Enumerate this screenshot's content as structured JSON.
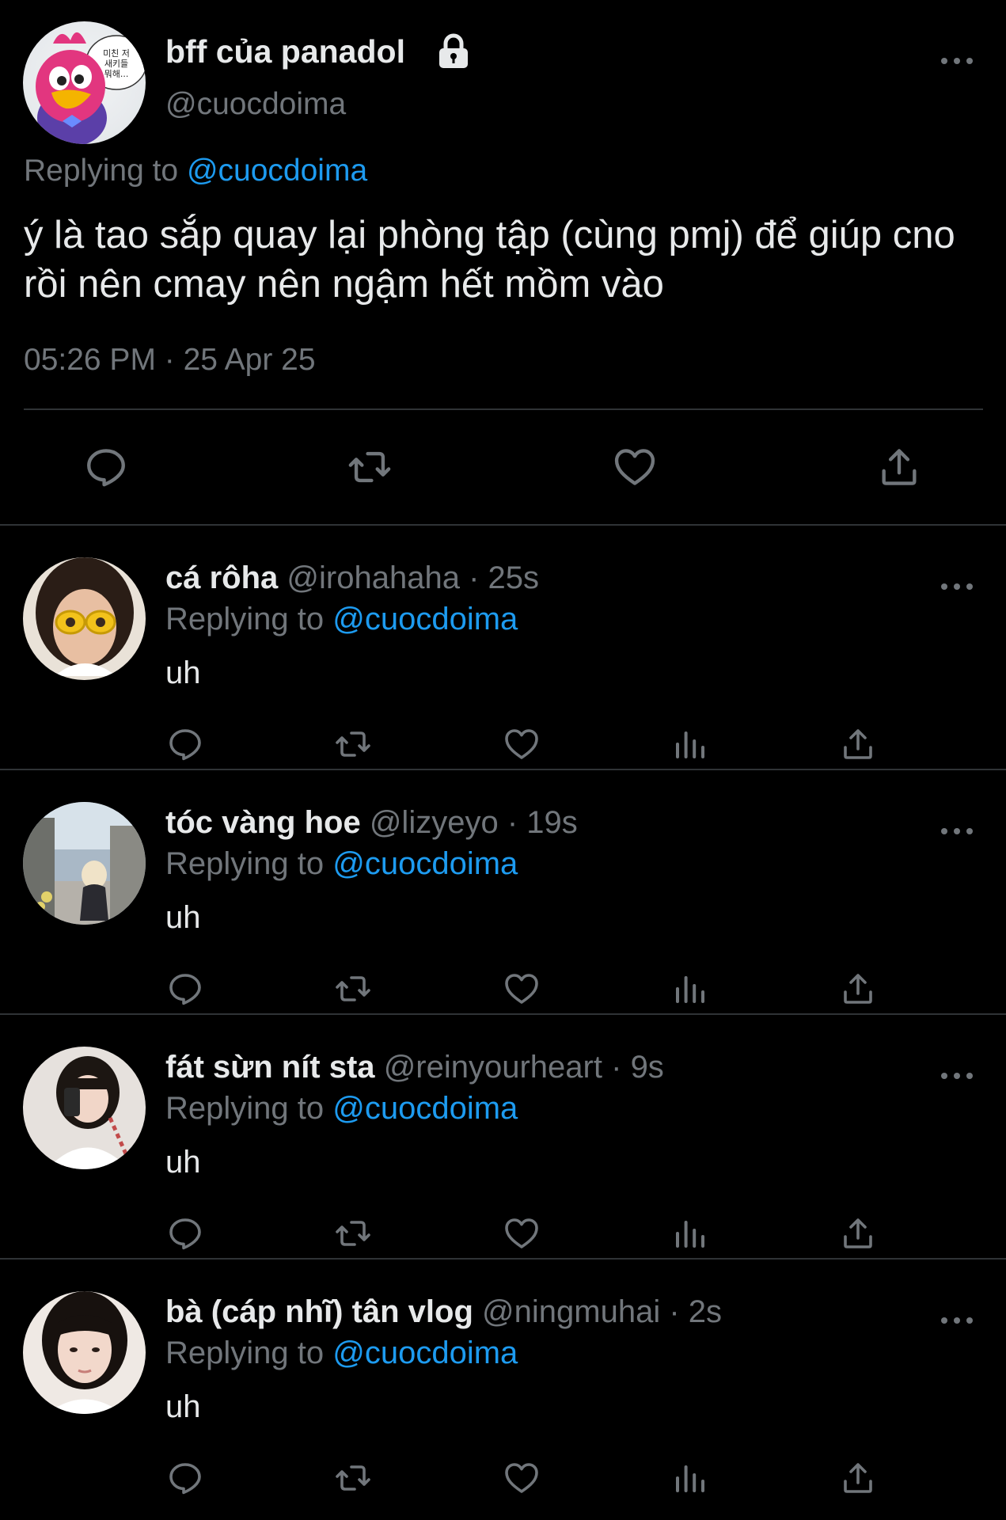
{
  "main_tweet": {
    "avatar": "cartoon-penguin-avatar",
    "avatar_speech_text": "미친 저 새키들 뭐해...",
    "display_name": "bff của panadol",
    "handle": "@cuocdoima",
    "replying_prefix": "Replying to ",
    "replying_to": "@cuocdoima",
    "text": "ý là tao sắp quay lại phòng tập (cùng pmj) để giúp cno rồi nên cmay nên ngậm hết mồm vào",
    "timestamp": "05:26 PM · 25 Apr 25",
    "icons": {
      "protected": "lock-icon",
      "more": "more-icon",
      "actions": [
        "reply-icon",
        "retweet-icon",
        "like-icon",
        "share-icon"
      ]
    }
  },
  "replies": [
    {
      "display_name": "cá rôha",
      "handle": "@irohahaha",
      "separator": "·",
      "time": "25s",
      "replying_prefix": "Replying to ",
      "replying_to": "@cuocdoima",
      "text": "uh"
    },
    {
      "display_name": "tóc vàng hoe",
      "handle": "@lizyeyo",
      "separator": "·",
      "time": "19s",
      "replying_prefix": "Replying to ",
      "replying_to": "@cuocdoima",
      "text": "uh"
    },
    {
      "display_name": "fát sừn nít sta",
      "handle": "@reinyourheart",
      "separator": "·",
      "time": "9s",
      "replying_prefix": "Replying to ",
      "replying_to": "@cuocdoima",
      "text": "uh"
    },
    {
      "display_name": "bà (cáp nhĩ) tân vlog",
      "handle": "@ningmuhai",
      "separator": "·",
      "time": "2s",
      "replying_prefix": "Replying to ",
      "replying_to": "@cuocdoima",
      "text": "uh"
    }
  ],
  "reply_action_icons": [
    "reply-icon",
    "retweet-icon",
    "like-icon",
    "views-icon",
    "share-icon"
  ],
  "colors": {
    "background": "#000000",
    "primary_text": "#e7e9ea",
    "secondary_text": "#71767b",
    "accent": "#1d9bf0",
    "divider": "#2f3336"
  }
}
